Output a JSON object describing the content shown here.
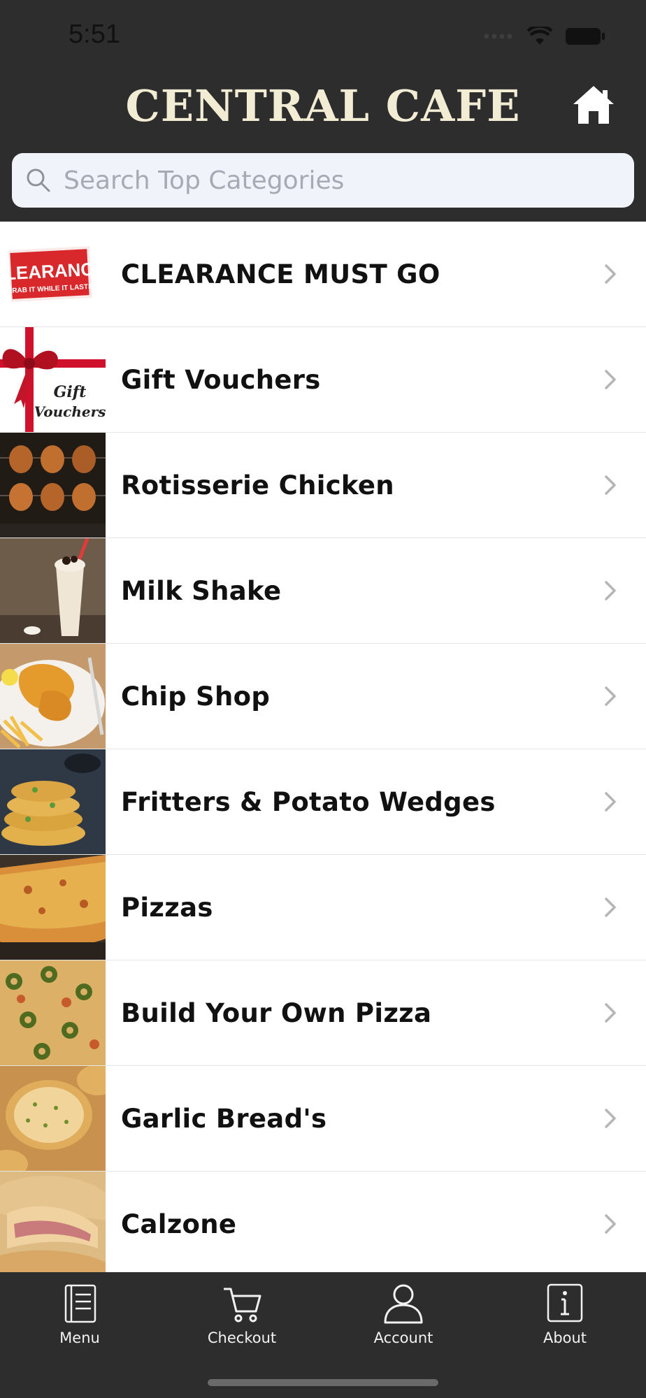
{
  "status": {
    "time": "5:51"
  },
  "header": {
    "title": "CENTRAL CAFE",
    "home_icon": "home-icon"
  },
  "search": {
    "placeholder": "Search Top Categories",
    "value": ""
  },
  "categories": [
    {
      "label": "CLEARANCE MUST GO",
      "thumb_text": [
        "CLEARANCE",
        "GRAB IT WHILE IT LASTS"
      ]
    },
    {
      "label": "Gift Vouchers",
      "thumb_text": [
        "Gift",
        "Vouchers"
      ]
    },
    {
      "label": "Rotisserie Chicken"
    },
    {
      "label": "Milk Shake"
    },
    {
      "label": "Chip Shop"
    },
    {
      "label": "Fritters & Potato Wedges"
    },
    {
      "label": "Pizzas"
    },
    {
      "label": "Build Your Own Pizza"
    },
    {
      "label": "Garlic Bread's"
    },
    {
      "label": "Calzone"
    }
  ],
  "tabs": [
    {
      "label": "Menu",
      "icon": "menu-icon"
    },
    {
      "label": "Checkout",
      "icon": "cart-icon"
    },
    {
      "label": "Account",
      "icon": "user-icon"
    },
    {
      "label": "About",
      "icon": "info-icon"
    }
  ],
  "colors": {
    "bar": "#2d2d2d",
    "title": "#f3ecd4",
    "list_bg": "#ffffff"
  }
}
